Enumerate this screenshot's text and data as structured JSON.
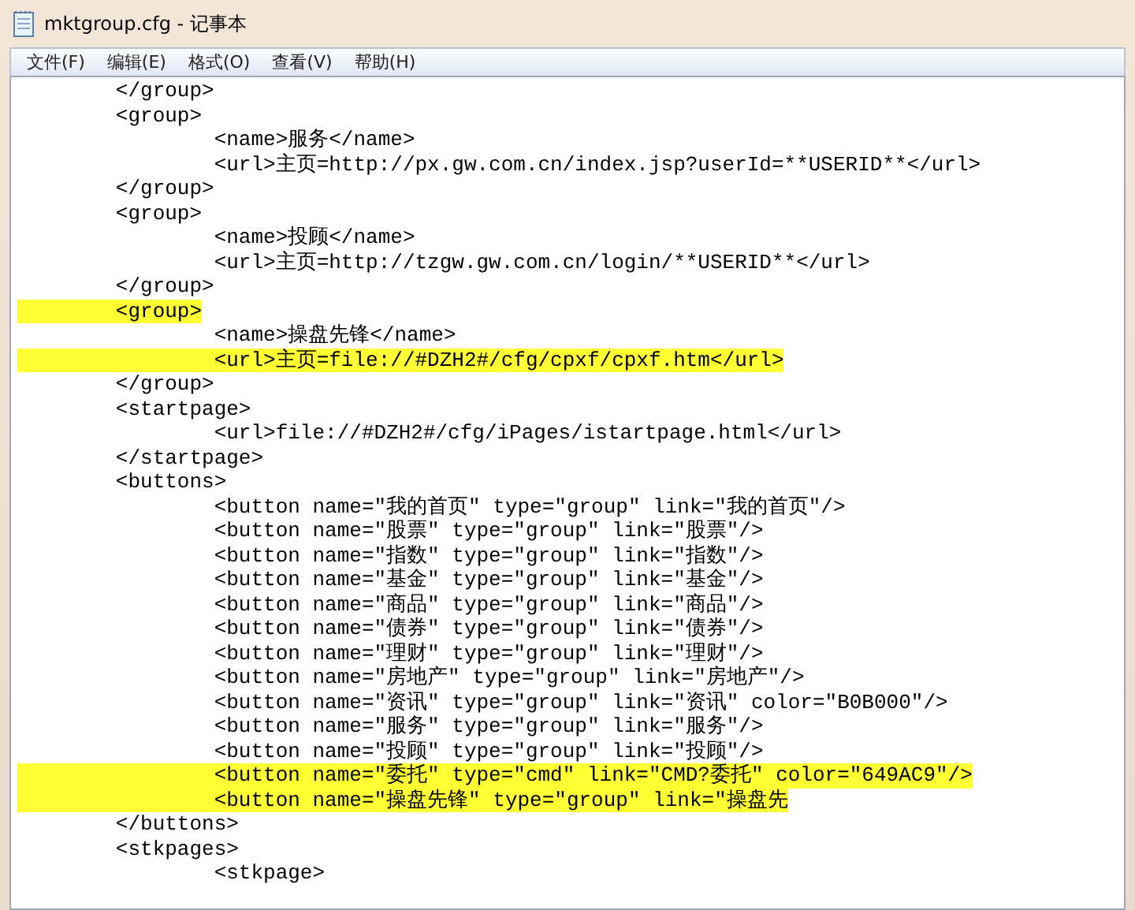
{
  "window": {
    "title": "mktgroup.cfg - 记事本"
  },
  "menu": [
    "文件(F)",
    "编辑(E)",
    "格式(O)",
    "查看(V)",
    "帮助(H)"
  ],
  "lines": [
    {
      "text": "\t</group>",
      "highlighted": false
    },
    {
      "text": "\t<group>",
      "highlighted": false
    },
    {
      "text": "\t\t<name>服务</name>",
      "highlighted": false
    },
    {
      "text": "\t\t<url>主页=http://px.gw.com.cn/index.jsp?userId=**USERID**</url>",
      "highlighted": false
    },
    {
      "text": "\t</group>",
      "highlighted": false
    },
    {
      "text": "\t<group>",
      "highlighted": false
    },
    {
      "text": "\t\t<name>投顾</name>",
      "highlighted": false
    },
    {
      "text": "\t\t<url>主页=http://tzgw.gw.com.cn/login/**USERID**</url>",
      "highlighted": false
    },
    {
      "text": "\t</group>",
      "highlighted": false
    },
    {
      "text": "\t<group>",
      "highlighted": true
    },
    {
      "text": "\t\t<name>操盘先锋</name>",
      "highlighted": false
    },
    {
      "text": "\t\t<url>主页=file://#DZH2#/cfg/cpxf/cpxf.htm</url>",
      "highlighted": true
    },
    {
      "text": "\t</group>",
      "highlighted": false
    },
    {
      "text": "\t<startpage>",
      "highlighted": false
    },
    {
      "text": "\t\t<url>file://#DZH2#/cfg/iPages/istartpage.html</url>",
      "highlighted": false
    },
    {
      "text": "\t</startpage>",
      "highlighted": false
    },
    {
      "text": "\t<buttons>",
      "highlighted": false
    },
    {
      "text": "\t\t<button name=\"我的首页\" type=\"group\" link=\"我的首页\"/>",
      "highlighted": false
    },
    {
      "text": "\t\t<button name=\"股票\" type=\"group\" link=\"股票\"/>",
      "highlighted": false
    },
    {
      "text": "\t\t<button name=\"指数\" type=\"group\" link=\"指数\"/>",
      "highlighted": false
    },
    {
      "text": "\t\t<button name=\"基金\" type=\"group\" link=\"基金\"/>",
      "highlighted": false
    },
    {
      "text": "\t\t<button name=\"商品\" type=\"group\" link=\"商品\"/>",
      "highlighted": false
    },
    {
      "text": "\t\t<button name=\"债券\" type=\"group\" link=\"债券\"/>",
      "highlighted": false
    },
    {
      "text": "\t\t<button name=\"理财\" type=\"group\" link=\"理财\"/>",
      "highlighted": false
    },
    {
      "text": "\t\t<button name=\"房地产\" type=\"group\" link=\"房地产\"/>",
      "highlighted": false
    },
    {
      "text": "\t\t<button name=\"资讯\" type=\"group\" link=\"资讯\" color=\"B0B000\"/>",
      "highlighted": false
    },
    {
      "text": "\t\t<button name=\"服务\" type=\"group\" link=\"服务\"/>",
      "highlighted": false
    },
    {
      "text": "\t\t<button name=\"投顾\" type=\"group\" link=\"投顾\"/>",
      "highlighted": false
    },
    {
      "text": "\t\t<button name=\"委托\" type=\"cmd\" link=\"CMD?委托\" color=\"649AC9\"/>",
      "highlighted": true
    },
    {
      "text": "\t\t<button name=\"操盘先锋\" type=\"group\" link=\"操盘先",
      "highlighted": true
    },
    {
      "text": "\t</buttons>",
      "highlighted": false
    },
    {
      "text": "\t<stkpages>",
      "highlighted": false
    },
    {
      "text": "\t\t<stkpage>",
      "highlighted": false
    }
  ]
}
